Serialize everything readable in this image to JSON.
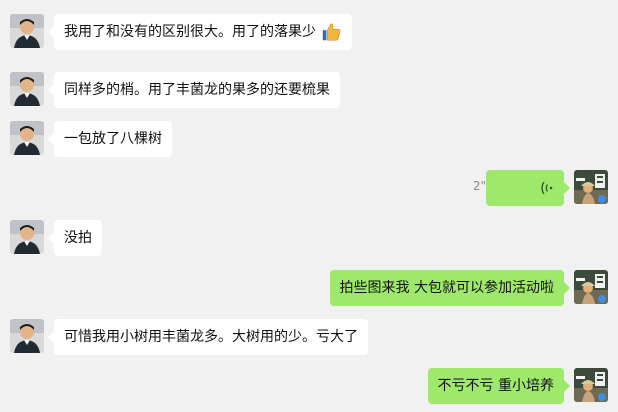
{
  "messages": [
    {
      "side": "left",
      "text": "我用了和没有的区别很大。用了的落果少",
      "has_thumb_emoji": true
    },
    {
      "side": "left",
      "text": "同样多的梢。用了丰菌龙的果多的还要梳果"
    },
    {
      "side": "left",
      "text": "一包放了八棵树"
    },
    {
      "side": "right",
      "type": "voice",
      "duration": "2\""
    },
    {
      "side": "left",
      "text": "没拍"
    },
    {
      "side": "right",
      "text": "拍些图来我  大包就可以参加活动啦"
    },
    {
      "side": "left",
      "text": "可惜我用小树用丰菌龙多。大树用的少。亏大了"
    },
    {
      "side": "right",
      "text": "不亏不亏  重小培养"
    }
  ],
  "colors": {
    "background": "#f1f1f1",
    "incoming_bubble": "#ffffff",
    "outgoing_bubble": "#9ee86b"
  }
}
